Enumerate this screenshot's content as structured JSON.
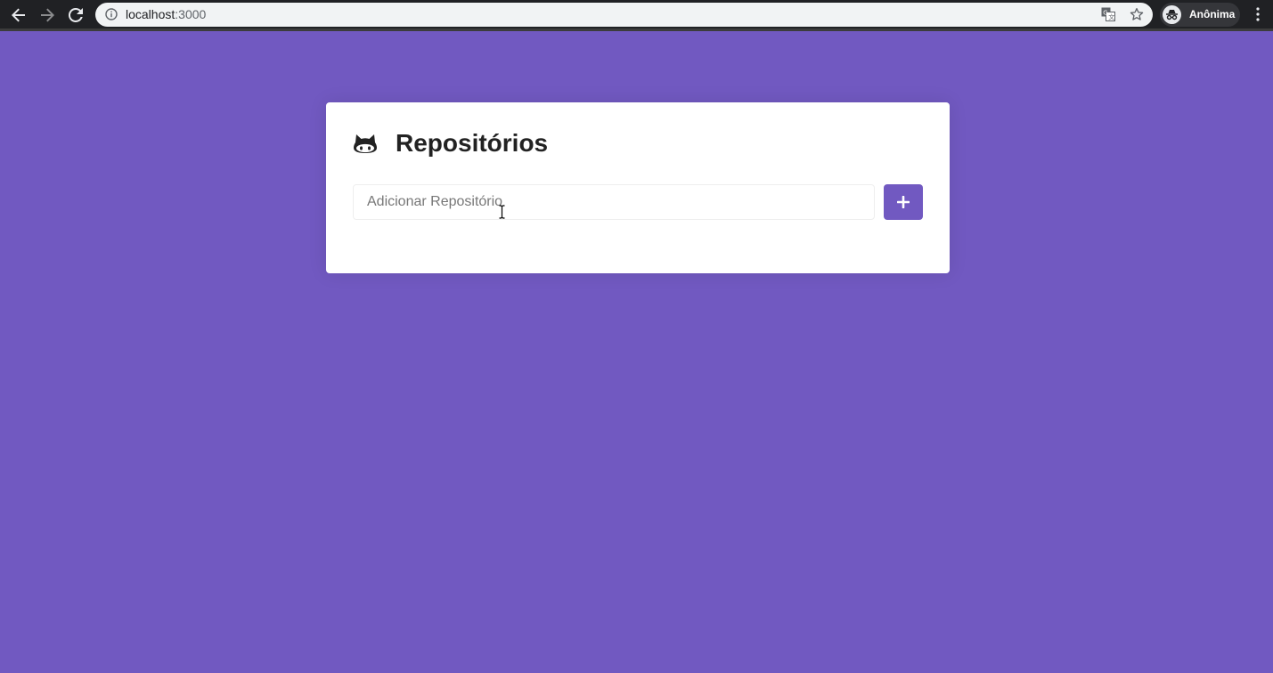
{
  "browser": {
    "url_host": "localhost",
    "url_port": ":3000",
    "profile_name": "Anônima",
    "icons": [
      "back-arrow-icon",
      "forward-arrow-icon",
      "reload-icon",
      "info-icon",
      "translate-icon",
      "star-icon",
      "incognito-icon",
      "more-vert-icon"
    ]
  },
  "page": {
    "background": "#7159c1",
    "title": "Repositórios",
    "title_icon": "github-icon",
    "input": {
      "placeholder": "Adicionar Repositório",
      "value": ""
    },
    "add_button": {
      "icon": "plus-icon",
      "color": "#7159c1"
    }
  }
}
